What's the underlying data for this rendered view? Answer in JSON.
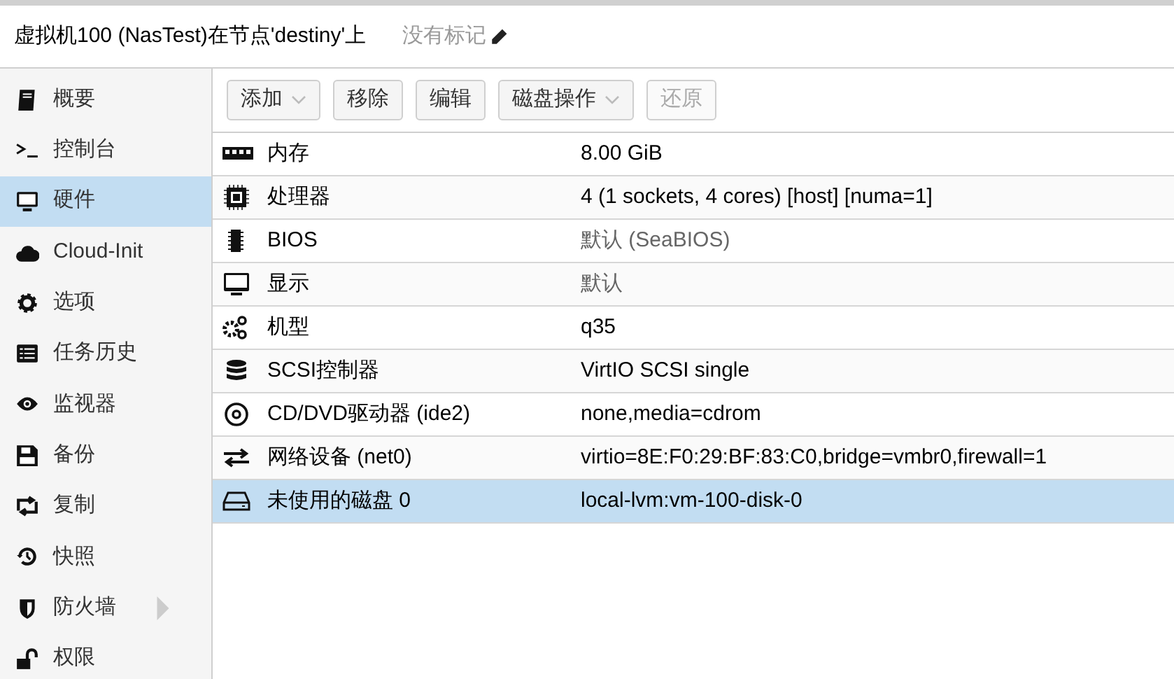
{
  "header": {
    "title": "虚拟机100 (NasTest)在节点'destiny'上",
    "tags": "没有标记"
  },
  "sidebar": {
    "items": [
      {
        "label": "概要",
        "selected": false
      },
      {
        "label": "控制台",
        "selected": false
      },
      {
        "label": "硬件",
        "selected": true
      },
      {
        "label": "Cloud-Init",
        "selected": false
      },
      {
        "label": "选项",
        "selected": false
      },
      {
        "label": "任务历史",
        "selected": false
      },
      {
        "label": "监视器",
        "selected": false
      },
      {
        "label": "备份",
        "selected": false
      },
      {
        "label": "复制",
        "selected": false
      },
      {
        "label": "快照",
        "selected": false
      },
      {
        "label": "防火墙",
        "selected": false,
        "has_submenu": true
      },
      {
        "label": "权限",
        "selected": false
      }
    ]
  },
  "toolbar": [
    {
      "label": "添加",
      "dropdown": true,
      "disabled": false
    },
    {
      "label": "移除",
      "dropdown": false,
      "disabled": false
    },
    {
      "label": "编辑",
      "dropdown": false,
      "disabled": false
    },
    {
      "label": "磁盘操作",
      "dropdown": true,
      "disabled": false
    },
    {
      "label": "还原",
      "dropdown": false,
      "disabled": true
    }
  ],
  "table": {
    "rows": [
      {
        "name": "内存",
        "value": "8.00 GiB",
        "is_default": false,
        "selected": false
      },
      {
        "name": "处理器",
        "value": "4 (1 sockets, 4 cores) [host] [numa=1]",
        "is_default": false,
        "selected": false
      },
      {
        "name": "BIOS",
        "value": "默认 (SeaBIOS)",
        "is_default": true,
        "selected": false
      },
      {
        "name": "显示",
        "value": "默认",
        "is_default": true,
        "selected": false
      },
      {
        "name": "机型",
        "value": "q35",
        "is_default": false,
        "selected": false
      },
      {
        "name": "SCSI控制器",
        "value": "VirtIO SCSI single",
        "is_default": false,
        "selected": false
      },
      {
        "name": "CD/DVD驱动器 (ide2)",
        "value": "none,media=cdrom",
        "is_default": false,
        "selected": false
      },
      {
        "name": "网络设备 (net0)",
        "value": "virtio=8E:F0:29:BF:83:C0,bridge=vmbr0,firewall=1",
        "is_default": false,
        "selected": false
      },
      {
        "name": "未使用的磁盘 0",
        "value": "local-lvm:vm-100-disk-0",
        "is_default": false,
        "selected": true
      }
    ]
  }
}
